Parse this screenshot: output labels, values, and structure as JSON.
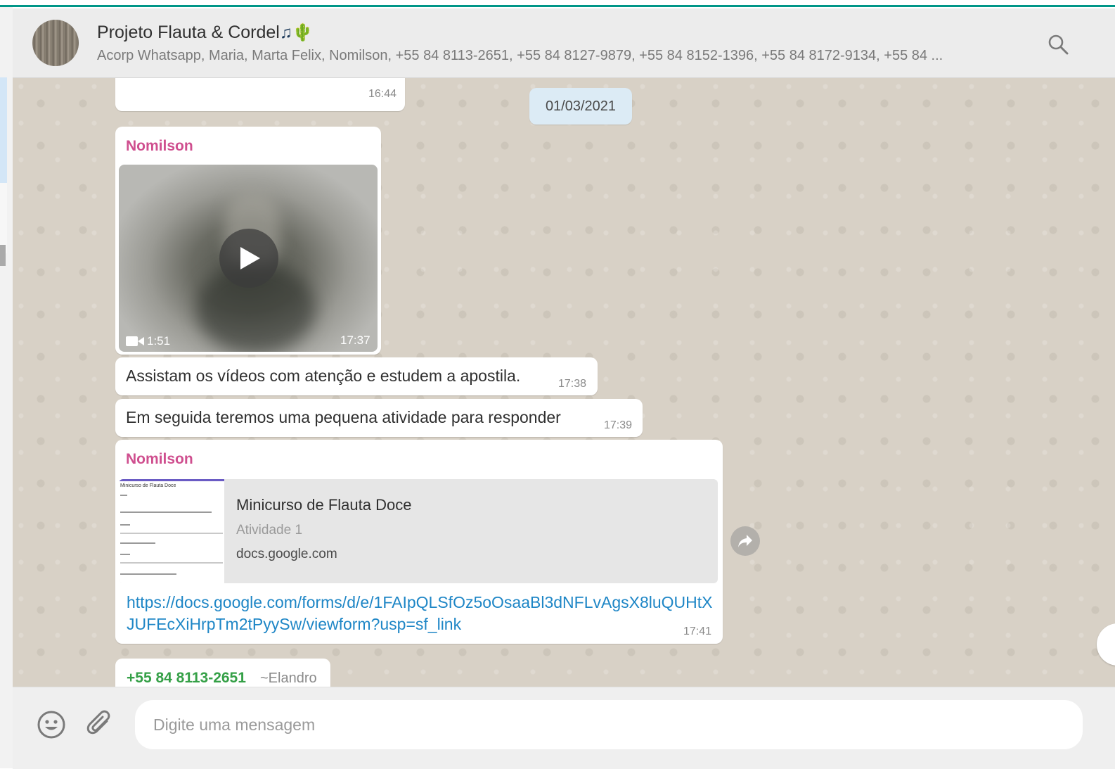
{
  "header": {
    "title": "Projeto Flauta & Cordel",
    "title_icons": [
      "musical-notes-icon",
      "cactus-icon"
    ],
    "participants": "Acorp Whatsapp, Maria, Marta Felix, Nomilson, +55 84 8113-2651, +55 84 8127-9879, +55 84 8152-1396, +55 84 8172-9134, +55 84 ...",
    "search_icon": "search-icon"
  },
  "chat": {
    "prev_message_time": "16:44",
    "date_chip": "01/03/2021",
    "messages": [
      {
        "sender": "Nomilson",
        "type": "video",
        "duration": "1:51",
        "time": "17:37"
      },
      {
        "type": "text",
        "text": "Assistam os vídeos com atenção e estudem a apostila.",
        "time": "17:38"
      },
      {
        "type": "text",
        "text": "Em seguida teremos uma pequena atividade para responder",
        "time": "17:39"
      },
      {
        "sender": "Nomilson",
        "type": "link",
        "preview_title": "Minicurso de Flauta Doce",
        "preview_desc": "Atividade 1",
        "preview_domain": "docs.google.com",
        "preview_thumb_heading": "Minicurso de Flauta Doce",
        "url": "https://docs.google.com/forms/d/e/1FAIpQLSfOz5oOsaaBl3dNFLvAgsX8luQUHtXJUFEcXiHrpTm2tPyySw/viewform?usp=sf_link",
        "time": "17:41"
      },
      {
        "type": "partial",
        "sender_phone": "+55 84 8113-2651",
        "sender_alias": "~Elandro"
      }
    ]
  },
  "composer": {
    "placeholder": "Digite uma mensagem",
    "emoji_icon": "emoji-icon",
    "attach_icon": "paperclip-icon"
  },
  "colors": {
    "accent": "#009688",
    "sender_name": "#cf4f8f",
    "phone_sender": "#35a047",
    "link": "#1e86c6",
    "date_chip": "#dcebf5",
    "chat_bg": "#d8d1c6"
  }
}
